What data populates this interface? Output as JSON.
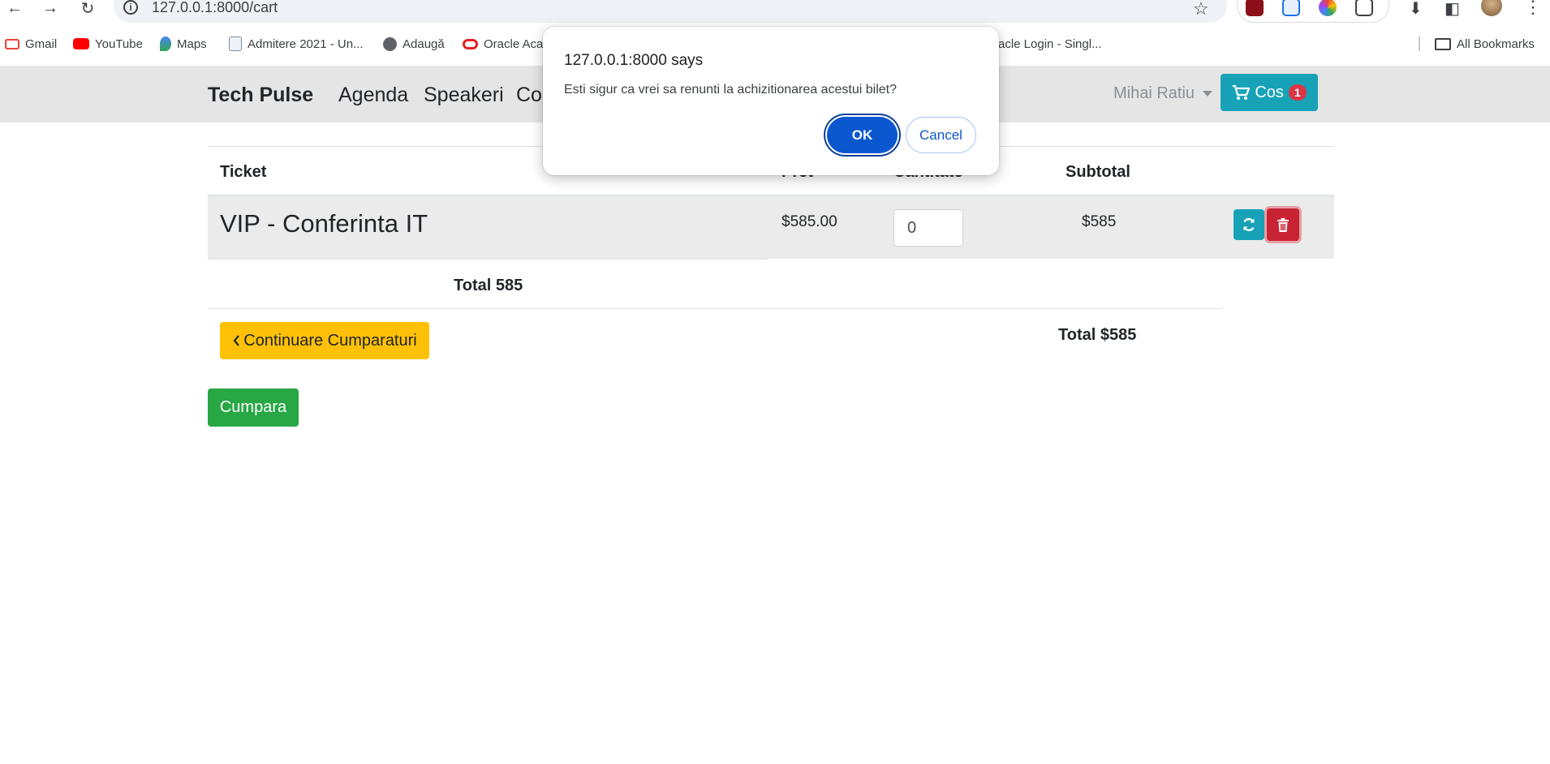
{
  "browser": {
    "url": "127.0.0.1:8000/cart",
    "bookmarks": [
      "Gmail",
      "YouTube",
      "Maps",
      "Admitere 2021 - Un...",
      "Adaugă",
      "Oracle Aca",
      "racle Login - Singl..."
    ],
    "all_bookmarks": "All Bookmarks"
  },
  "navbar": {
    "brand": "Tech Pulse",
    "links": [
      "Agenda",
      "Speakeri",
      "Co"
    ],
    "user": "Mihai Ratiu",
    "cart_label": "Cos",
    "cart_count": "1"
  },
  "cart": {
    "headers": {
      "ticket": "Ticket",
      "price": "Pret",
      "quantity": "Cantitate",
      "subtotal": "Subtotal"
    },
    "items": [
      {
        "name": "VIP - Conferinta IT",
        "price": "$585.00",
        "quantity": "0",
        "subtotal": "$585"
      }
    ],
    "total_left": "Total 585",
    "total_right": "Total $585",
    "continue_label": "Continuare Cumparaturi",
    "buy_label": "Cumpara"
  },
  "dialog": {
    "title": "127.0.0.1:8000 says",
    "message": "Esti sigur ca vrei sa renunti la achizitionarea acestui bilet?",
    "ok": "OK",
    "cancel": "Cancel"
  },
  "colors": {
    "info": "#17a2b8",
    "danger": "#dc3545",
    "warning": "#ffc107",
    "success": "#28a745",
    "dialog_primary": "#0b57d0"
  }
}
